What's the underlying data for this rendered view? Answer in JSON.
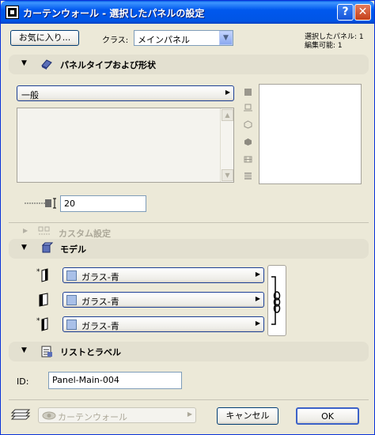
{
  "window": {
    "title": "カーテンウォール - 選択したパネルの設定"
  },
  "toolbar": {
    "favorites_label": "お気に入り...",
    "class_label": "クラス:",
    "class_value": "メインパネル",
    "info_line1": "選択したパネル: 1",
    "info_line2": "編集可能: 1"
  },
  "section_panel_type": {
    "title": "パネルタイプおよび形状",
    "type_value": "一般",
    "thickness_value": "20"
  },
  "section_custom": {
    "title": "カスタム設定"
  },
  "section_model": {
    "title": "モデル",
    "materials": [
      "ガラス-青",
      "ガラス-青",
      "ガラス-青"
    ],
    "swatch_color": "#a9c0e8"
  },
  "section_list": {
    "title": "リストとラベル",
    "id_label": "ID:",
    "id_value": "Panel-Main-004"
  },
  "footer": {
    "layer_value": "カーテンウォール",
    "cancel_label": "キャンセル",
    "ok_label": "OK"
  }
}
